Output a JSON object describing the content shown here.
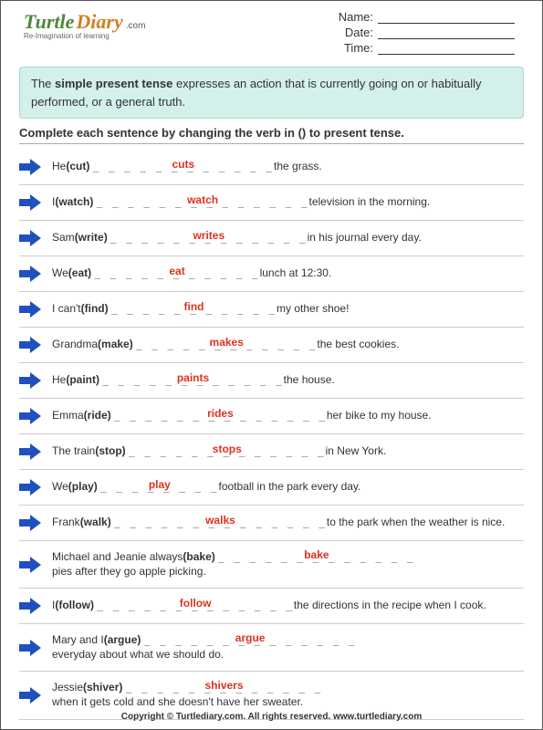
{
  "logo": {
    "turtle": "Turtle",
    "diary": "Diary",
    "com": ".com",
    "tagline": "Re-Imagination of learning"
  },
  "fields": {
    "name": "Name:",
    "date": "Date:",
    "time": "Time:"
  },
  "definition": {
    "pre": "The ",
    "bold": "simple present tense",
    "post": " expresses an action that is currently going on or habitually performed, or a general truth."
  },
  "instruction": "Complete each sentence by changing the verb in () to present tense.",
  "items": [
    {
      "pre": "He ",
      "verb": "(cut)",
      "blank": "_ _ _ _ _ _ _ _ _ _ _ _",
      "answer": "cuts",
      "post": " the grass."
    },
    {
      "pre": "I ",
      "verb": "(watch)",
      "blank": "_ _ _ _ _ _ _ _ _ _ _ _ _ _",
      "answer": "watch",
      "post": " television in the morning."
    },
    {
      "pre": "Sam ",
      "verb": "(write)",
      "blank": "_ _ _ _ _ _ _ _ _ _ _ _ _",
      "answer": "writes",
      "post": " in his journal every day."
    },
    {
      "pre": "We ",
      "verb": "(eat)",
      "blank": "_ _ _ _ _ _ _ _ _ _ _",
      "answer": "eat",
      "post": "  lunch at 12:30."
    },
    {
      "pre": "I can't ",
      "verb": "(find)",
      "blank": "_ _ _ _ _ _ _ _ _ _ _",
      "answer": "find",
      "post": " my other shoe!"
    },
    {
      "pre": "Grandma ",
      "verb": "(make)",
      "blank": "_ _ _ _ _ _ _ _ _ _ _ _",
      "answer": "makes",
      "post": " the best cookies."
    },
    {
      "pre": "He ",
      "verb": "(paint)",
      "blank": "_ _ _ _ _ _ _ _ _ _ _ _",
      "answer": "paints",
      "post": " the house."
    },
    {
      "pre": "Emma ",
      "verb": "(ride)",
      "blank": "_ _ _ _ _ _ _ _ _ _ _ _ _ _",
      "answer": "rides",
      "post": " her bike to my house."
    },
    {
      "pre": "The train ",
      "verb": "(stop)",
      "blank": "_ _ _ _ _ _ _ _ _ _ _ _ _",
      "answer": "stops",
      "post": " in New York."
    },
    {
      "pre": "We ",
      "verb": "(play)",
      "blank": "_ _ _ _ _ _ _ _",
      "answer": "play",
      "post": " football in the park every day."
    },
    {
      "pre": "Frank ",
      "verb": "(walk)",
      "blank": "_ _ _ _ _ _ _ _ _ _ _ _ _ _",
      "answer": "walks",
      "post": " to the park when the weather is nice."
    },
    {
      "pre": "Michael and Jeanie always ",
      "verb": "(bake)",
      "blank": "_ _ _ _ _ _ _ _ _ _ _ _ _",
      "answer": "bake",
      "post": " pies after they go apple picking."
    },
    {
      "pre": "I ",
      "verb": "(follow)",
      "blank": "_ _ _ _ _ _ _ _ _ _ _ _ _",
      "answer": "follow",
      "post": " the directions in the recipe when I cook."
    },
    {
      "pre": "Mary and I ",
      "verb": "(argue)",
      "blank": "_ _ _ _ _ _ _ _ _ _ _ _ _ _",
      "answer": "argue",
      "post": " everyday about what we should do."
    },
    {
      "pre": "Jessie ",
      "verb": "(shiver)",
      "blank": "_ _ _ _ _ _ _ _ _ _ _ _ _",
      "answer": "shivers",
      "post": " when it gets cold and she doesn't have her sweater."
    }
  ],
  "footer": "Copyright © Turtlediary.com. All rights reserved. www.turtlediary.com"
}
